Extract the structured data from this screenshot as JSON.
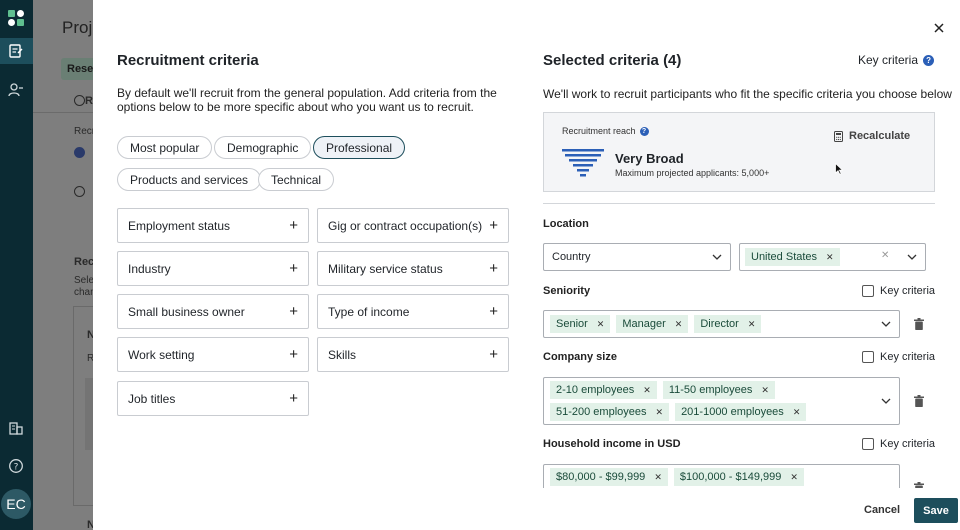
{
  "rail": {
    "avatar_initials": "EC",
    "icons": [
      "logo-icon",
      "projects-icon",
      "participants-icon",
      "organization-icon",
      "help-icon"
    ]
  },
  "background": {
    "title": "Proje",
    "tab_label": "Resea",
    "text_1": "Re",
    "text_2": "Recr",
    "text_3": "Rec",
    "text_4": "Selec",
    "text_5": "chan",
    "text_6": "N",
    "text_7": "R",
    "text_8": "N"
  },
  "left": {
    "title": "Recruitment criteria",
    "description": "By default we'll recruit from the general population. Add criteria from the options below to be more specific about who you want us to recruit.",
    "filters": [
      {
        "label": "Most popular",
        "active": false
      },
      {
        "label": "Demographic",
        "active": false
      },
      {
        "label": "Professional",
        "active": true
      },
      {
        "label": "Products and services",
        "active": false
      },
      {
        "label": "Technical",
        "active": false
      }
    ],
    "criteria": [
      "Employment status",
      "Gig or contract occupation(s)",
      "Industry",
      "Military service status",
      "Small business owner",
      "Type of income",
      "Work setting",
      "Skills",
      "Job titles"
    ]
  },
  "right": {
    "title": "Selected criteria (4)",
    "key_criteria_link": "Key criteria",
    "description": "We'll work to recruit participants who fit the specific criteria you choose below",
    "reach": {
      "label": "Recruitment reach",
      "level": "Very Broad",
      "max_applicants": "Maximum projected applicants: 5,000+",
      "recalculate": "Recalculate"
    },
    "location": {
      "label": "Location",
      "type_value": "Country",
      "country_tag": "United States"
    },
    "seniority": {
      "label": "Seniority",
      "key_label": "Key criteria",
      "tags": [
        "Senior",
        "Manager",
        "Director"
      ]
    },
    "company_size": {
      "label": "Company size",
      "key_label": "Key criteria",
      "tags": [
        "2-10 employees",
        "11-50 employees",
        "51-200 employees",
        "201-1000 employees"
      ]
    },
    "household_income": {
      "label": "Household income in USD",
      "key_label": "Key criteria",
      "tags": [
        "$80,000 - $99,999",
        "$100,000 - $149,999"
      ]
    }
  },
  "footer": {
    "cancel": "Cancel",
    "save": "Save"
  },
  "colors": {
    "accent": "#1d4e5c",
    "tag_bg": "#e2f1e8",
    "help": "#2b5fb7"
  }
}
